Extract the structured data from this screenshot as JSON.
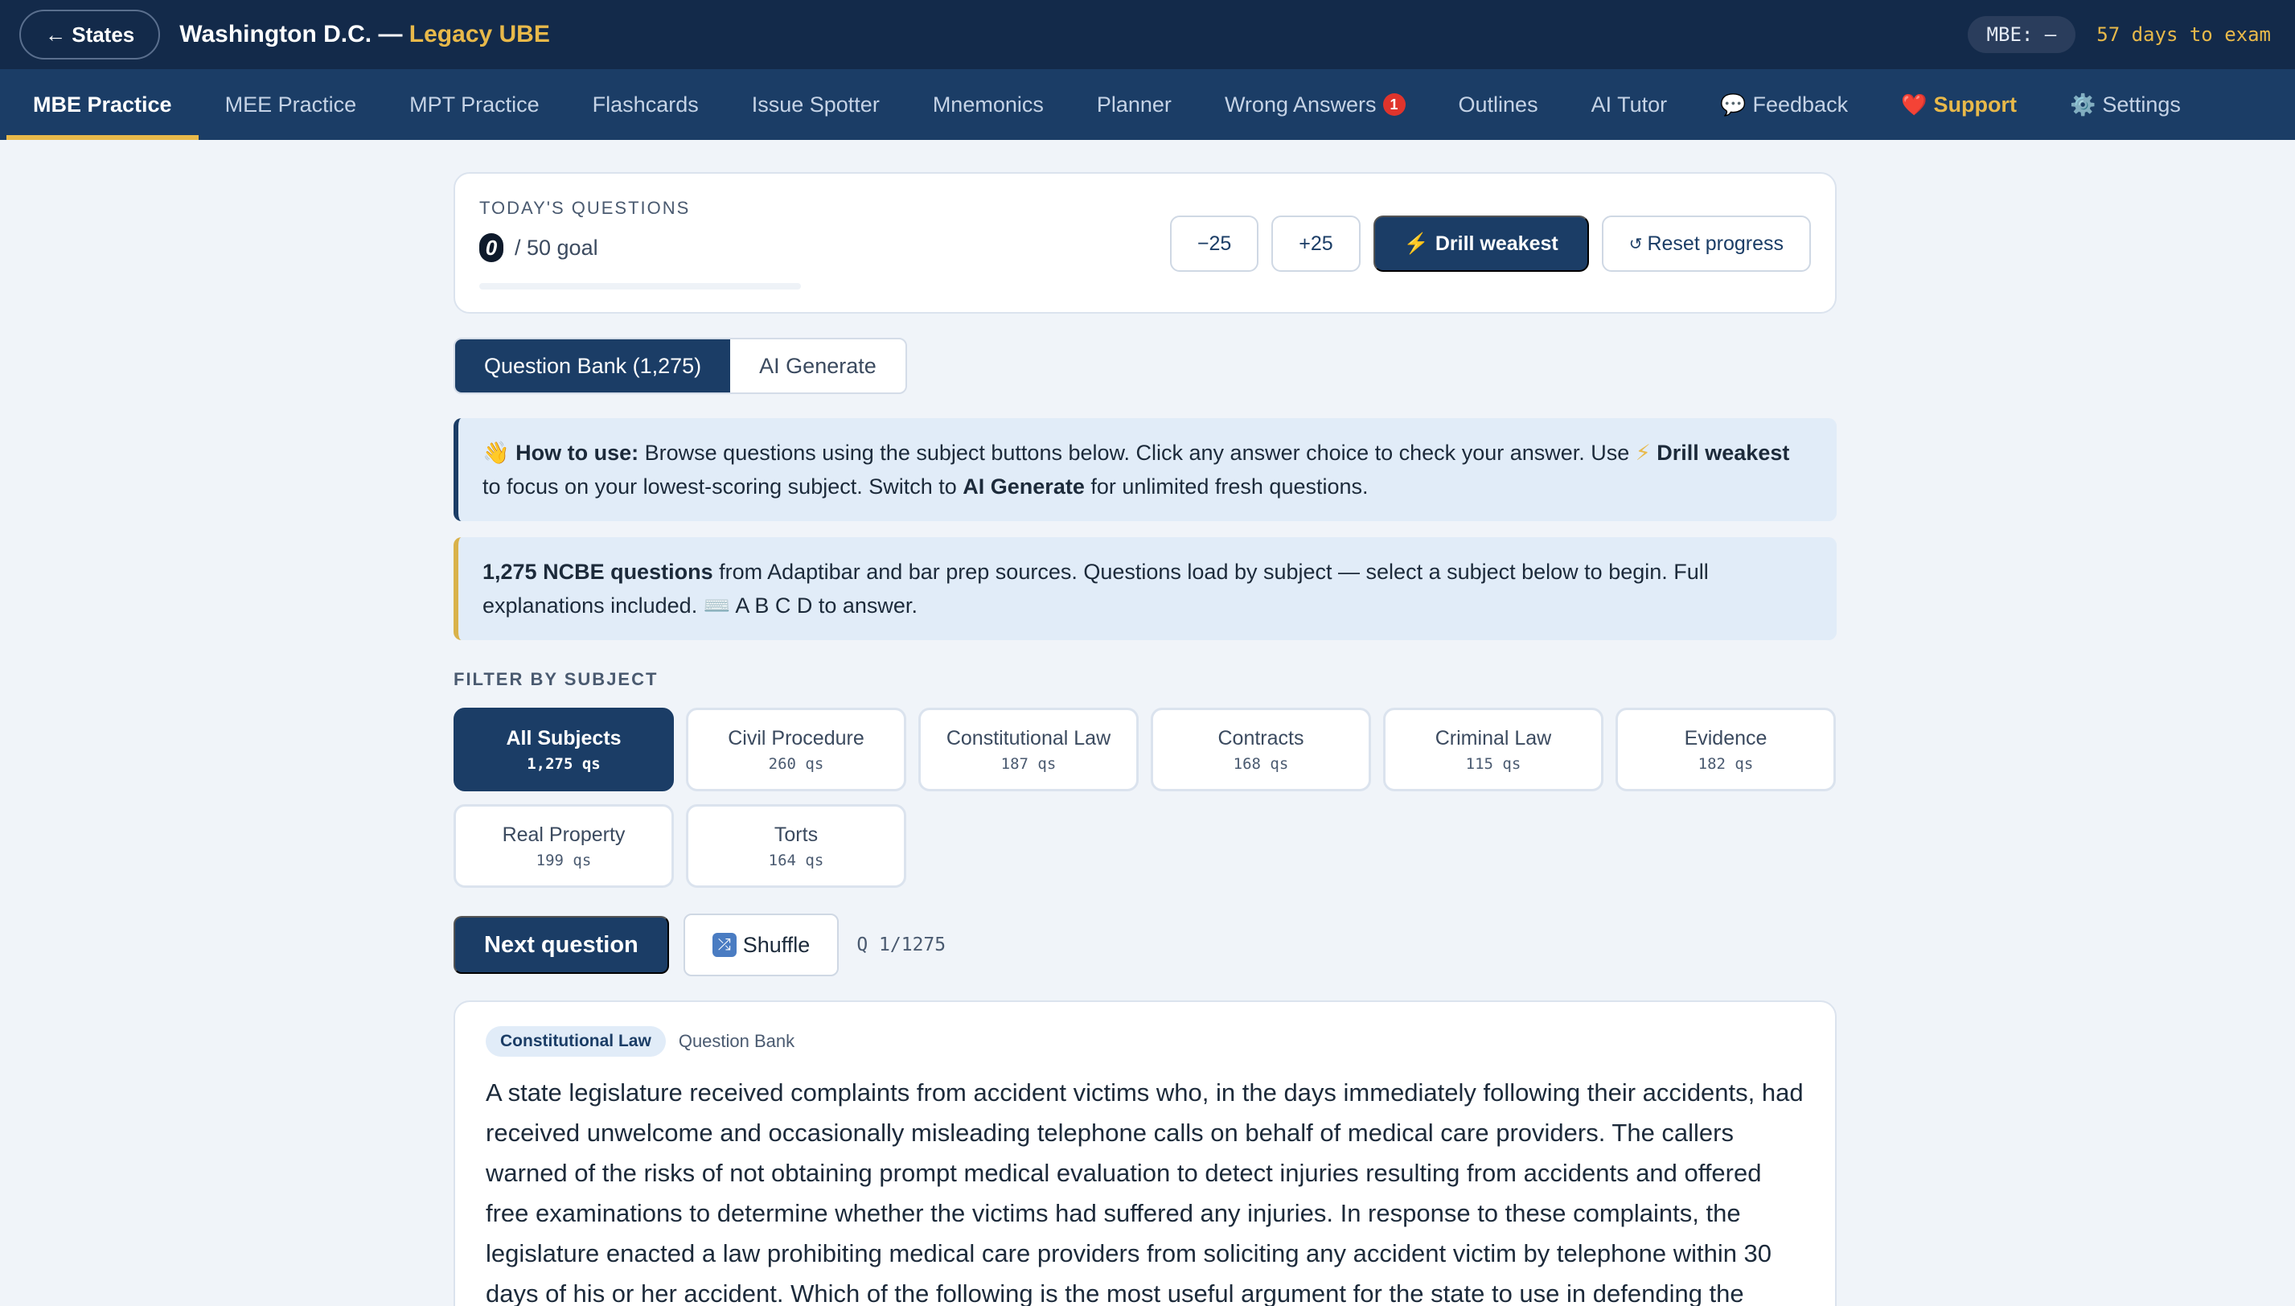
{
  "topbar": {
    "back_label": "← States",
    "title_main": "Washington D.C. — ",
    "title_accent": "Legacy UBE",
    "mbe_pill": "MBE: —",
    "days_to_exam": "57 days to exam"
  },
  "nav": {
    "items": [
      {
        "label": "MBE Practice"
      },
      {
        "label": "MEE Practice"
      },
      {
        "label": "MPT Practice"
      },
      {
        "label": "Flashcards"
      },
      {
        "label": "Issue Spotter"
      },
      {
        "label": "Mnemonics"
      },
      {
        "label": "Planner"
      },
      {
        "label": "Wrong Answers",
        "badge": "1"
      },
      {
        "label": "Outlines"
      },
      {
        "label": "AI Tutor"
      },
      {
        "label": "Feedback",
        "icon": "speech-bubble-icon"
      },
      {
        "label": "Support",
        "icon": "heart-icon"
      },
      {
        "label": "Settings",
        "icon": "gear-icon"
      }
    ]
  },
  "today": {
    "label": "TODAY'S QUESTIONS",
    "count": "0",
    "goal": "/ 50 goal",
    "progress_fraction": 0,
    "minus_label": "−25",
    "plus_label": "+25",
    "drill_label": "Drill weakest",
    "reset_label": "Reset progress"
  },
  "source_tabs": {
    "bank": "Question Bank (1,275)",
    "ai": "AI Generate"
  },
  "how_to": {
    "lead": "How to use:",
    "text1": " Browse questions using the subject buttons below. Click any answer choice to check your answer. Use ",
    "drill": "Drill weakest",
    "text2": " to focus on your lowest-scoring subject. Switch to ",
    "ai": "AI Generate",
    "text3": " for unlimited fresh questions."
  },
  "bank_info": {
    "lead": "1,275 NCBE questions",
    "text1": " from Adaptibar and bar prep sources. Questions load by subject — select a subject below to begin. Full explanations included. ",
    "text2": " A B C D to answer."
  },
  "filter": {
    "label": "FILTER BY SUBJECT",
    "subjects": [
      {
        "name": "All Subjects",
        "count": "1,275 qs"
      },
      {
        "name": "Civil Procedure",
        "count": "260 qs"
      },
      {
        "name": "Constitutional Law",
        "count": "187 qs"
      },
      {
        "name": "Contracts",
        "count": "168 qs"
      },
      {
        "name": "Criminal Law",
        "count": "115 qs"
      },
      {
        "name": "Evidence",
        "count": "182 qs"
      },
      {
        "name": "Real Property",
        "count": "199 qs"
      },
      {
        "name": "Torts",
        "count": "164 qs"
      }
    ]
  },
  "controls": {
    "next_label": "Next question",
    "shuffle_label": "Shuffle",
    "counter": "Q 1/1275"
  },
  "question": {
    "tag": "Constitutional Law",
    "source": "Question Bank",
    "text": "A state legislature received complaints from accident victims who, in the days immediately following their accidents, had received unwelcome and occasionally misleading telephone calls on behalf of medical care providers. The callers warned of the risks of not obtaining prompt medical evaluation to detect injuries resulting from accidents and offered free examinations to determine whether the victims had suffered any injuries. In response to these complaints, the legislature enacted a law prohibiting medical care providers from soliciting any accident victim by telephone within 30 days of his or her accident. Which of the following is the most useful argument for the state to use in defending the"
  },
  "colors": {
    "topbar": "#132a4a",
    "navbar": "#1b3d66",
    "accent_gold": "#e8b94a",
    "primary": "#1b3d66",
    "badge_red": "#e0342c",
    "page_bg": "#f0f4f9"
  }
}
